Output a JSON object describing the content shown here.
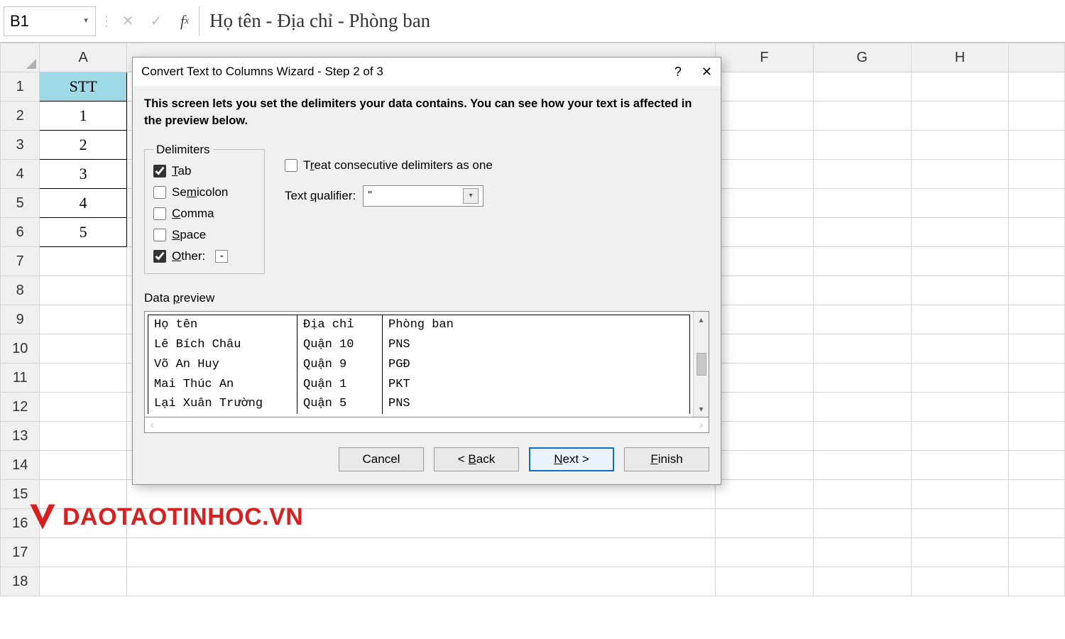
{
  "formulaBar": {
    "cellRef": "B1",
    "value": "Họ tên - Địa chỉ - Phòng ban"
  },
  "columns": [
    "A",
    "F",
    "G",
    "H"
  ],
  "rowHeaders": [
    "1",
    "2",
    "3",
    "4",
    "5",
    "6",
    "7",
    "8",
    "9",
    "10",
    "11",
    "12",
    "13",
    "14",
    "15",
    "16",
    "17",
    "18"
  ],
  "sheet": {
    "headerCell": "STT",
    "rows": [
      "1",
      "2",
      "3",
      "4",
      "5"
    ]
  },
  "dialog": {
    "title": "Convert Text to Columns Wizard - Step 2 of 3",
    "help": "?",
    "close": "✕",
    "desc": "This screen lets you set the delimiters your data contains.  You can see how your text is affected in the preview below.",
    "delimLegend": "Delimiters",
    "delims": {
      "tab": {
        "label": "Tab",
        "checked": true
      },
      "semicolon": {
        "label": "Semicolon",
        "checked": false
      },
      "comma": {
        "label": "Comma",
        "checked": false
      },
      "space": {
        "label": "Space",
        "checked": false
      },
      "other": {
        "label": "Other:",
        "checked": true,
        "value": "-"
      }
    },
    "treatConsec": {
      "label": "Treat consecutive delimiters as one",
      "checked": false
    },
    "textQualLabel": "Text qualifier:",
    "textQualValue": "\"",
    "previewLabel": "Data preview",
    "preview": [
      [
        "Họ tên",
        "Địa chỉ",
        "Phòng ban"
      ],
      [
        "Lê Bích Châu",
        "Quận 10",
        "PNS"
      ],
      [
        "Võ An Huy",
        "Quận 9",
        "PGĐ"
      ],
      [
        "Mai Thúc An",
        "Quận 1",
        "PKT"
      ],
      [
        "Lại Xuân Trường",
        "Quận 5",
        "PNS"
      ]
    ],
    "buttons": {
      "cancel": "Cancel",
      "back": "< Back",
      "next": "Next >",
      "finish": "Finish"
    }
  },
  "watermark": "DAOTAOTINHOC.VN"
}
